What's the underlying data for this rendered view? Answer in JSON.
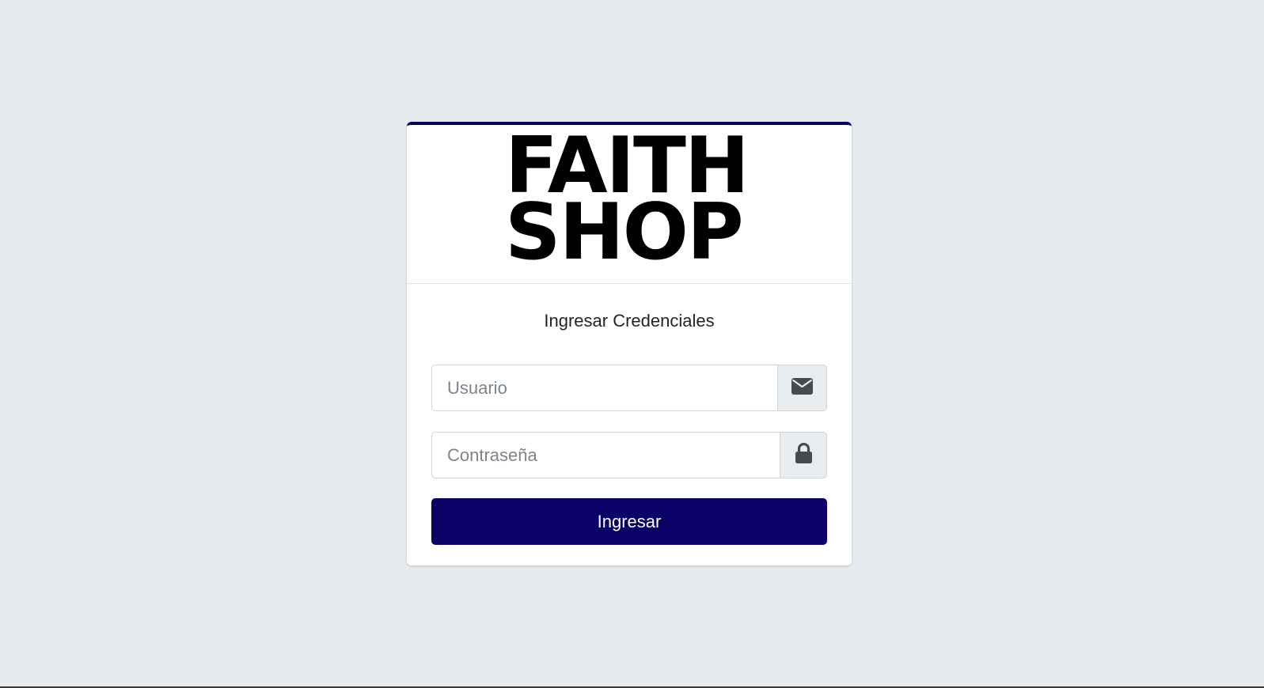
{
  "logo": {
    "line1": "FAITH",
    "line2": "SHOP"
  },
  "login": {
    "title": "Ingresar Credenciales",
    "username_placeholder": "Usuario",
    "username_icon": "envelope-icon",
    "password_placeholder": "Contraseña",
    "password_icon": "lock-icon",
    "submit_label": "Ingresar"
  },
  "colors": {
    "accent": "#0b0066",
    "background": "#e8ebee",
    "addon": "#e9ecef"
  }
}
